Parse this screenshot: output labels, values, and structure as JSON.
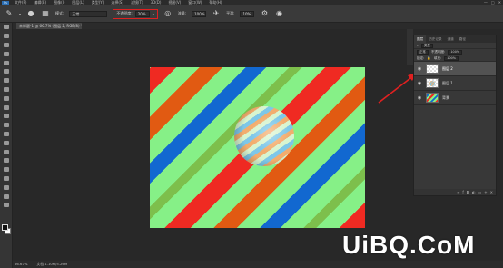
{
  "menubar": {
    "logo": "Ps",
    "items": [
      "文件(F)",
      "编辑(E)",
      "图像(I)",
      "图层(L)",
      "类型(Y)",
      "选择(S)",
      "滤镜(T)",
      "3D(D)",
      "视图(V)",
      "窗口(W)",
      "帮助(H)"
    ],
    "window_controls": [
      "—",
      "□",
      "✕"
    ]
  },
  "options": {
    "mode_label": "模式:",
    "mode_value": "正常",
    "opacity_label": "不透明度:",
    "opacity_value": "20%",
    "flow_label": "流量:",
    "flow_value": "100%",
    "smooth_label": "平滑:",
    "smooth_value": "10%"
  },
  "tab": {
    "label": "未标题-1 @ 66.7% (图层 2, RGB/8) *"
  },
  "layers_panel": {
    "tabs": [
      "图层",
      "历史记录",
      "通道",
      "路径"
    ],
    "kind_label": "类型",
    "blend_mode": "正常",
    "opacity_label": "不透明度:",
    "opacity_value": "100%",
    "lock_label": "锁定:",
    "fill_label": "填充:",
    "fill_value": "100%",
    "layers": [
      {
        "name": "图层 2",
        "selected": true
      },
      {
        "name": "图层 1",
        "selected": false
      },
      {
        "name": "背景",
        "selected": false
      }
    ]
  },
  "status": {
    "zoom": "66.67%",
    "doc": "文档:1.10M/5.26M"
  },
  "watermark": {
    "text": "UiBQ.CoM"
  },
  "colors": {
    "highlight_box": "#e02020",
    "arrow": "#e02020",
    "stripe_red": "#ef2a22",
    "stripe_green": "#86f087",
    "stripe_blue": "#1268d0",
    "stripe_orange": "#e15a12"
  }
}
